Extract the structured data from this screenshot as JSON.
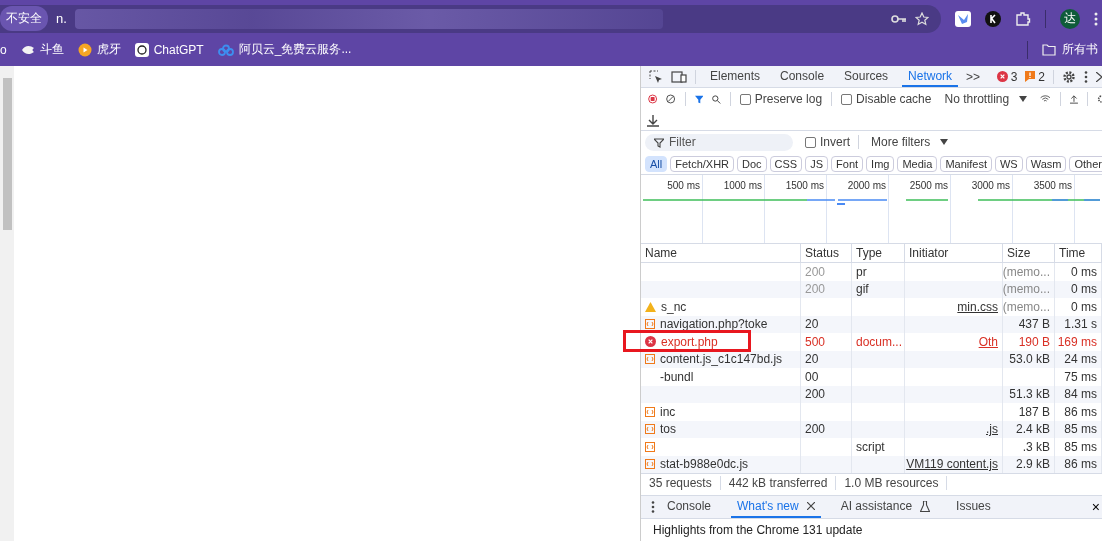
{
  "browser": {
    "security_label": "不安全",
    "url": "n.",
    "avatar": "达",
    "bookmarks": [
      {
        "label": "o",
        "kind": "none"
      },
      {
        "label": "斗鱼",
        "kind": "fish"
      },
      {
        "label": "虎牙",
        "kind": "play"
      },
      {
        "label": "ChatGPT",
        "kind": "knot"
      },
      {
        "label": "阿贝云_免费云服务...",
        "kind": "cloud"
      }
    ],
    "all_bookmarks": "所有书"
  },
  "devtools": {
    "tabs": [
      {
        "label": "Elements",
        "selected": false
      },
      {
        "label": "Console",
        "selected": false
      },
      {
        "label": "Sources",
        "selected": false
      },
      {
        "label": "Network",
        "selected": true
      }
    ],
    "more_tabs": ">>",
    "errors": "3",
    "warnings": "2",
    "preserve_log": {
      "label": "Preserve log",
      "checked": false
    },
    "disable_cache": {
      "label": "Disable cache",
      "checked": false
    },
    "throttling": "No throttling",
    "filter": {
      "placeholder": "Filter"
    },
    "invert": {
      "label": "Invert",
      "checked": false
    },
    "more_filters": "More filters",
    "type_filters": [
      {
        "label": "All",
        "selected": true
      },
      {
        "label": "Fetch/XHR",
        "selected": false
      },
      {
        "label": "Doc",
        "selected": false
      },
      {
        "label": "CSS",
        "selected": false
      },
      {
        "label": "JS",
        "selected": false
      },
      {
        "label": "Font",
        "selected": false
      },
      {
        "label": "Img",
        "selected": false
      },
      {
        "label": "Media",
        "selected": false
      },
      {
        "label": "Manifest",
        "selected": false
      },
      {
        "label": "WS",
        "selected": false
      },
      {
        "label": "Wasm",
        "selected": false
      },
      {
        "label": "Other",
        "selected": false
      }
    ],
    "overview_ticks": [
      "500 ms",
      "1000 ms",
      "1500 ms",
      "2000 ms",
      "2500 ms",
      "3000 ms",
      "3500 ms"
    ],
    "table": {
      "columns": [
        "Name",
        "Status",
        "Type",
        "Initiator",
        "Size",
        "Time"
      ],
      "rows": [
        {
          "kind": "blank",
          "name": "",
          "status": "200",
          "type": "pr",
          "initiator": "",
          "size": "(memo...",
          "time": "0 ms",
          "from_cache": true,
          "failed": false,
          "highlighted": false
        },
        {
          "kind": "blank",
          "name": "",
          "status": "200",
          "type": "gif",
          "initiator": "",
          "size": "(memo...",
          "time": "0 ms",
          "from_cache": true,
          "failed": false,
          "highlighted": false
        },
        {
          "kind": "warning",
          "name": "s_nc",
          "status": "",
          "type": "",
          "initiator": "min.css",
          "size": "(memo...",
          "time": "0 ms",
          "from_cache": true,
          "failed": false,
          "highlighted": false
        },
        {
          "kind": "document",
          "name": "navigation.php?toke",
          "status": "20",
          "type": "",
          "initiator": "",
          "size": "437 B",
          "time": "1.31 s",
          "from_cache": false,
          "failed": false,
          "highlighted": false
        },
        {
          "kind": "error",
          "name": "export.php",
          "status": "500",
          "type": "docum...",
          "initiator": "Oth",
          "size": "190 B",
          "time": "169 ms",
          "from_cache": false,
          "failed": true,
          "highlighted": true
        },
        {
          "kind": "script",
          "name": "content.js_c1c147bd.js",
          "status": "20",
          "type": "",
          "initiator": "",
          "size": "53.0 kB",
          "time": "24 ms",
          "from_cache": false,
          "failed": false,
          "highlighted": false
        },
        {
          "kind": "blank",
          "name": "-bundl",
          "status": "00",
          "type": "",
          "initiator": "",
          "size": "",
          "time": "75 ms",
          "from_cache": false,
          "failed": false,
          "highlighted": false
        },
        {
          "kind": "blank",
          "name": "",
          "status": "200",
          "type": "",
          "initiator": "",
          "size": "51.3 kB",
          "time": "84 ms",
          "from_cache": false,
          "failed": false,
          "highlighted": false
        },
        {
          "kind": "script",
          "name": "inc",
          "status": "",
          "type": "",
          "initiator": "",
          "size": "187 B",
          "time": "86 ms",
          "from_cache": false,
          "failed": false,
          "highlighted": false
        },
        {
          "kind": "script",
          "name": "tos",
          "status": "200",
          "type": "",
          "initiator": ".js",
          "size": "2.4 kB",
          "time": "85 ms",
          "from_cache": false,
          "failed": false,
          "highlighted": false
        },
        {
          "kind": "script",
          "name": "",
          "status": "",
          "type": "script",
          "initiator": "",
          "size": ".3 kB",
          "time": "85 ms",
          "from_cache": false,
          "failed": false,
          "highlighted": false
        },
        {
          "kind": "script",
          "name": "stat-b988e0dc.js",
          "status": "",
          "type": "",
          "initiator": "VM119 content.js",
          "size": "2.9 kB",
          "time": "86 ms",
          "from_cache": false,
          "failed": false,
          "highlighted": false
        }
      ]
    },
    "summary": [
      "35 requests",
      "442 kB transferred",
      "1.0 MB resources"
    ],
    "drawer": {
      "tabs": [
        {
          "label": "Console",
          "selected": false,
          "closable": false,
          "kind": "plain"
        },
        {
          "label": "What's new",
          "selected": true,
          "closable": true,
          "kind": "plain"
        },
        {
          "label": "AI assistance",
          "selected": false,
          "closable": false,
          "kind": "experimental"
        },
        {
          "label": "Issues",
          "selected": false,
          "closable": false,
          "kind": "plain"
        }
      ],
      "close_all": "×",
      "content": "Highlights from the Chrome 131 update"
    }
  }
}
